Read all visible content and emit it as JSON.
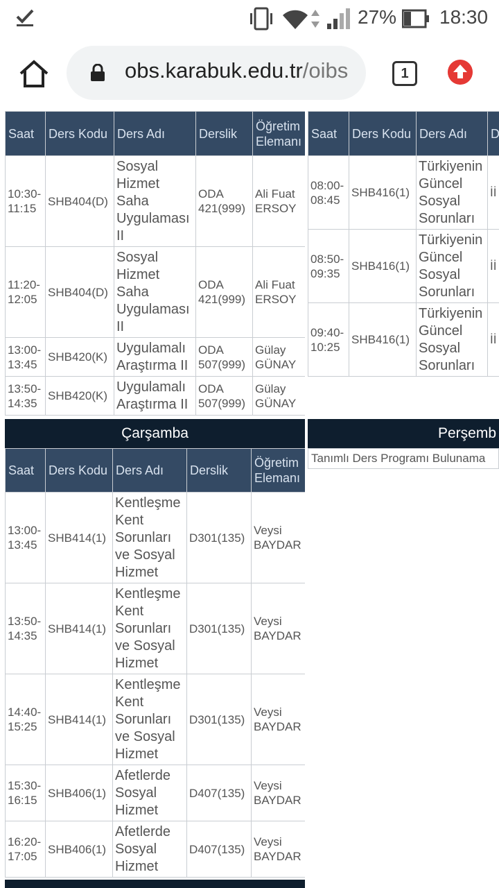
{
  "status_bar": {
    "battery_pct": "27%",
    "time": "18:30",
    "icons": [
      "check-icon",
      "vibrate-icon",
      "wifi-icon",
      "data-arrows-icon",
      "signal-icon",
      "battery-icon"
    ]
  },
  "browser": {
    "url_host": "obs.karabuk.edu.tr",
    "url_path": "/oibs",
    "tab_count": "1"
  },
  "headers": {
    "saat": "Saat",
    "ders_kodu": "Ders Kodu",
    "ders_adi": "Ders Adı",
    "derslik": "Derslik",
    "ogretim": "Öğretim Elemanı",
    "cut": "D"
  },
  "top_left": {
    "rows": [
      {
        "saat": "10:30-11:15",
        "kod": "SHB404(D)",
        "ad": "Sosyal Hizmet Saha Uygulaması II",
        "derslik": "ODA 421(999)",
        "ogretim": "Ali Fuat ERSOY"
      },
      {
        "saat": "11:20-12:05",
        "kod": "SHB404(D)",
        "ad": "Sosyal Hizmet Saha Uygulaması II",
        "derslik": "ODA 421(999)",
        "ogretim": "Ali Fuat ERSOY"
      },
      {
        "saat": "13:00-13:45",
        "kod": "SHB420(K)",
        "ad": "Uygulamalı Araştırma II",
        "derslik": "ODA 507(999)",
        "ogretim": "Gülay GÜNAY"
      },
      {
        "saat": "13:50-14:35",
        "kod": "SHB420(K)",
        "ad": "Uygulamalı Araştırma II",
        "derslik": "ODA 507(999)",
        "ogretim": "Gülay GÜNAY"
      }
    ]
  },
  "top_right": {
    "rows": [
      {
        "saat": "08:00-08:45",
        "kod": "SHB416(1)",
        "ad": "Türkiyenin Güncel Sosyal Sorunları",
        "cut": "İİ"
      },
      {
        "saat": "08:50-09:35",
        "kod": "SHB416(1)",
        "ad": "Türkiyenin Güncel Sosyal Sorunları",
        "cut": "İİ"
      },
      {
        "saat": "09:40-10:25",
        "kod": "SHB416(1)",
        "ad": "Türkiyenin Güncel Sosyal Sorunları",
        "cut": "İİ"
      }
    ]
  },
  "carsamba": {
    "day": "Çarşamba",
    "rows": [
      {
        "saat": "13:00-13:45",
        "kod": "SHB414(1)",
        "ad": "Kentleşme Kent Sorunları ve Sosyal Hizmet",
        "derslik": "D301(135)",
        "ogretim": "Veysi BAYDAR"
      },
      {
        "saat": "13:50-14:35",
        "kod": "SHB414(1)",
        "ad": "Kentleşme Kent Sorunları ve Sosyal Hizmet",
        "derslik": "D301(135)",
        "ogretim": "Veysi BAYDAR"
      },
      {
        "saat": "14:40-15:25",
        "kod": "SHB414(1)",
        "ad": "Kentleşme Kent Sorunları ve Sosyal Hizmet",
        "derslik": "D301(135)",
        "ogretim": "Veysi BAYDAR"
      },
      {
        "saat": "15:30-16:15",
        "kod": "SHB406(1)",
        "ad": "Afetlerde Sosyal Hizmet",
        "derslik": "D407(135)",
        "ogretim": "Veysi BAYDAR"
      },
      {
        "saat": "16:20-17:05",
        "kod": "SHB406(1)",
        "ad": "Afetlerde Sosyal Hizmet",
        "derslik": "D407(135)",
        "ogretim": "Veysi BAYDAR"
      }
    ]
  },
  "persembe": {
    "day": "Perşemb",
    "empty_note": "Tanımlı Ders Programı Bulunama"
  }
}
